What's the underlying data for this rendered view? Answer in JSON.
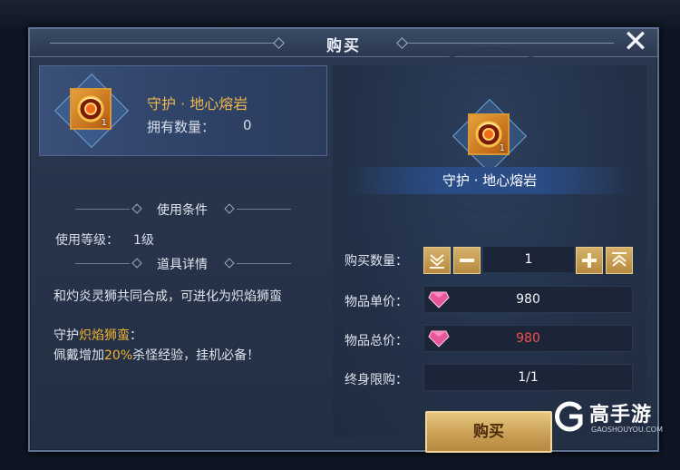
{
  "dialog": {
    "title": "购买",
    "close_symbol": "✕"
  },
  "item": {
    "name": "守护 · 地心熔岩",
    "icon": "lava-amulet-icon",
    "icon_count": "1",
    "owned_label": "拥有数量：",
    "owned_value": "0"
  },
  "conditions": {
    "title": "使用条件",
    "level_label": "使用等级：",
    "level_value": "1级"
  },
  "details": {
    "title": "道具详情",
    "line1": "和灼炎灵狮共同合成，可进化为炽焰狮蛮",
    "line2_prefix": "守护",
    "line2_highlight": "炽焰狮蛮",
    "line2_suffix": "：",
    "line3_prefix": "佩戴增加",
    "line3_highlight": "20%",
    "line3_suffix": "杀怪经验，挂机必备！"
  },
  "purchase": {
    "quantity_label": "购买数量：",
    "quantity_value": "1",
    "unit_price_label": "物品单价：",
    "unit_price": "980",
    "total_price_label": "物品总价：",
    "total_price": "980",
    "limit_label": "终身限购：",
    "limit_value": "1/1",
    "buy_button": "购买",
    "currency_icon": "pink-diamond-icon"
  },
  "watermark": {
    "name": "高手游",
    "site": "GAOSHOUYOU.COM"
  },
  "colors": {
    "item_name": "#f1b94a",
    "highlight": "#f3b233",
    "total_price": "#f25050",
    "button_gold": "#caa056"
  }
}
